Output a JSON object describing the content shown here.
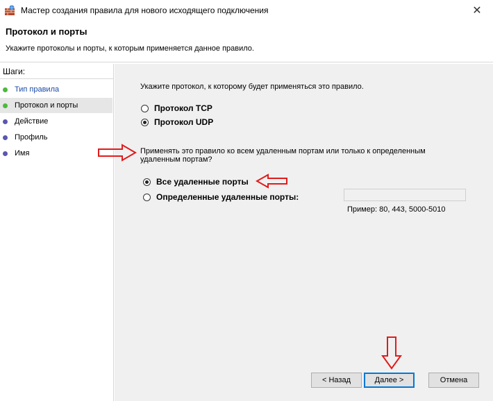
{
  "window": {
    "title": "Мастер создания правила для нового исходящего подключения"
  },
  "header": {
    "title": "Протокол и порты",
    "subtitle": "Укажите протоколы и порты, к которым применяется данное правило."
  },
  "sidebar": {
    "steps_label": "Шаги:",
    "items": [
      {
        "label": "Тип правила",
        "status": "done"
      },
      {
        "label": "Протокол и порты",
        "status": "current"
      },
      {
        "label": "Действие",
        "status": "todo"
      },
      {
        "label": "Профиль",
        "status": "todo"
      },
      {
        "label": "Имя",
        "status": "todo"
      }
    ]
  },
  "main": {
    "protocol_question": "Укажите протокол, к которому будет применяться это правило.",
    "protocols": [
      {
        "label": "Протокол TCP",
        "checked": false
      },
      {
        "label": "Протокол UDP",
        "checked": true
      }
    ],
    "ports_question_line1": "Применять это правило ко всем удаленным портам или только к определенным",
    "ports_question_line2": "удаленным портам?",
    "ports_options": [
      {
        "label": "Все удаленные порты",
        "checked": true
      },
      {
        "label": "Определенные удаленные порты:",
        "checked": false
      }
    ],
    "ports_input_value": "",
    "ports_example": "Пример: 80, 443, 5000-5010"
  },
  "buttons": {
    "back": "< Назад",
    "next": "Далее >",
    "cancel": "Отмена"
  },
  "colors": {
    "annotation_arrow": "#e01b1b",
    "step_done": "#4cba3c",
    "step_todo": "#5a57b0",
    "primary_border": "#0078d7"
  }
}
